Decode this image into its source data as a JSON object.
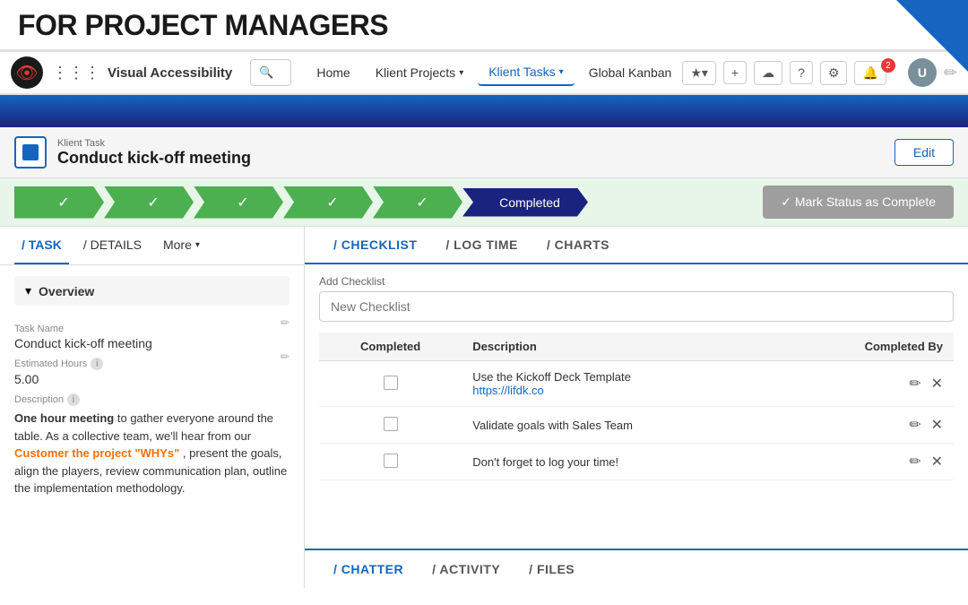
{
  "banner": {
    "title": "FOR PROJECT MANAGERS"
  },
  "navbar": {
    "logo_text": "●",
    "app_name": "Visual Accessibility",
    "search_placeholder": "Search...",
    "nav_items": [
      {
        "label": "Home",
        "active": false
      },
      {
        "label": "Klient Projects",
        "active": false,
        "has_dropdown": true
      },
      {
        "label": "Klient Tasks",
        "active": true,
        "has_dropdown": true
      },
      {
        "label": "Global Kanban",
        "active": false
      }
    ],
    "actions": {
      "star": "★",
      "add": "+",
      "cloud": "☁",
      "help": "?",
      "settings": "⚙",
      "notifications": "🔔",
      "notification_count": "2"
    }
  },
  "task_header": {
    "breadcrumb": "Klient Task",
    "title": "Conduct kick-off meeting",
    "edit_label": "Edit"
  },
  "pipeline": {
    "steps": [
      {
        "label": "✓",
        "completed": true
      },
      {
        "label": "✓",
        "completed": true
      },
      {
        "label": "✓",
        "completed": true
      },
      {
        "label": "✓",
        "completed": true
      },
      {
        "label": "✓",
        "completed": true
      }
    ],
    "current_step": "Completed",
    "mark_complete_label": "✓ Mark Status as Complete"
  },
  "left_panel": {
    "tabs": [
      {
        "label": "/ TASK",
        "active": true
      },
      {
        "label": "/ DETAILS",
        "active": false
      },
      {
        "label": "More",
        "active": false,
        "has_dropdown": true
      }
    ],
    "overview_label": "Overview",
    "fields": {
      "task_name_label": "Task Name",
      "task_name_value": "Conduct kick-off meeting",
      "estimated_hours_label": "Estimated Hours",
      "estimated_hours_value": "5.00",
      "description_label": "Description",
      "description_parts": [
        {
          "text": "One hour meeting",
          "style": "bold"
        },
        {
          "text": " to gather everyone around the table. As a collective team, we'll hear from our ",
          "style": "normal"
        },
        {
          "text": "Customer the project \"WHYs\"",
          "style": "orange"
        },
        {
          "text": ", present the goals, align the players, review communication plan, outline the implementation methodology.",
          "style": "normal"
        }
      ]
    }
  },
  "right_panel": {
    "tabs": [
      {
        "label": "/ CHECKLIST",
        "active": true
      },
      {
        "label": "/ LOG TIME",
        "active": false
      },
      {
        "label": "/ CHARTS",
        "active": false
      }
    ],
    "add_checklist_label": "Add Checklist",
    "add_checklist_placeholder": "New Checklist",
    "checklist_headers": [
      {
        "label": "Completed",
        "align": "center"
      },
      {
        "label": "Description",
        "align": "left"
      },
      {
        "label": "Completed By",
        "align": "right"
      }
    ],
    "checklist_items": [
      {
        "completed": false,
        "description": "Use the Kickoff Deck Template",
        "link": "https://lifdk.co",
        "completed_by": ""
      },
      {
        "completed": false,
        "description": "Validate goals with Sales Team",
        "link": "",
        "completed_by": ""
      },
      {
        "completed": false,
        "description": "Don't forget to log your time!",
        "link": "",
        "completed_by": ""
      }
    ]
  },
  "bottom_tabs": [
    {
      "label": "/ CHATTER",
      "active": true
    },
    {
      "label": "/ ACTIVITY",
      "active": false
    },
    {
      "label": "/ FILES",
      "active": false
    }
  ]
}
